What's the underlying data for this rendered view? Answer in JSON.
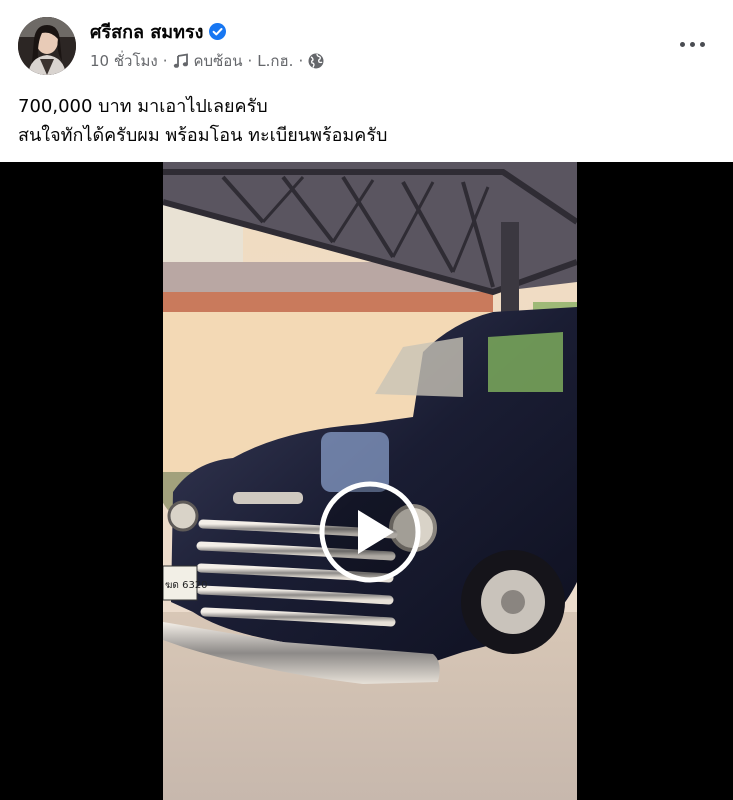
{
  "post": {
    "author": "ศรีสกล สมทรง",
    "time": "10 ชั่วโมง",
    "audio": "คบซ้อน",
    "audio_artist": "L.กฮ.",
    "separator": "·",
    "lines": [
      "700,000 บาท มาเอาไปเลยครับ",
      "สนใจทักได้ครับผม พร้อมโอน ทะเบียนพร้อมครับ"
    ]
  },
  "video": {
    "plate_text": "ฆด 6320"
  },
  "colors": {
    "verified_badge": "#1877f2",
    "meta_text": "#65676b",
    "video_background": "#000000",
    "car_body": "#1a1d33"
  },
  "icons": [
    "verified-badge-icon",
    "music-note-icon",
    "globe-icon",
    "more-options-icon",
    "play-icon"
  ]
}
